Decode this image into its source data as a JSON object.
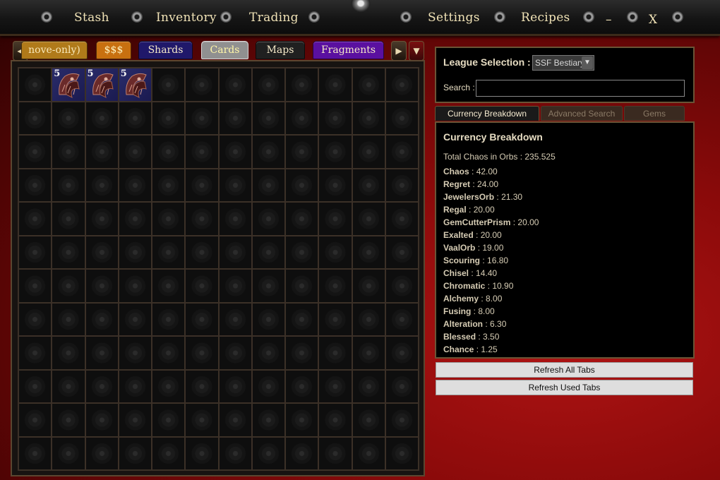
{
  "menu": {
    "items": [
      "Stash",
      "Inventory",
      "Trading",
      "Settings",
      "Recipes"
    ],
    "minimize": "–",
    "close": "X"
  },
  "tabs": {
    "items": [
      {
        "label": "nove-only)",
        "color": "#b07a1a"
      },
      {
        "label": "$$$",
        "color": "#c87010"
      },
      {
        "label": "Shards",
        "color": "#20186a"
      },
      {
        "label": "Cards",
        "color": "#909090"
      },
      {
        "label": "Maps",
        "color": "#202020"
      },
      {
        "label": "Fragments",
        "color": "#5a10a0"
      }
    ],
    "prev_icon": "left-arrow",
    "next_icon": "right-arrow",
    "menu_icon": "chevron-down"
  },
  "stash": {
    "items": [
      {
        "stack": "5",
        "col": 1
      },
      {
        "stack": "5",
        "col": 2
      },
      {
        "stack": "5",
        "col": 3
      }
    ]
  },
  "league": {
    "label": "League Selection :",
    "selected": "SSF Bestiary",
    "search_label": "Search :",
    "search_value": ""
  },
  "subtabs": [
    "Currency Breakdown",
    "Advanced Search",
    "Gems"
  ],
  "breakdown": {
    "title": "Currency Breakdown",
    "total": "Total Chaos in Orbs : 235.525",
    "rows": [
      {
        "name": "Chaos",
        "value": "42.00"
      },
      {
        "name": "Regret",
        "value": "24.00"
      },
      {
        "name": "JewelersOrb",
        "value": "21.30"
      },
      {
        "name": "Regal",
        "value": "20.00"
      },
      {
        "name": "GemCutterPrism",
        "value": "20.00"
      },
      {
        "name": "Exalted",
        "value": "20.00"
      },
      {
        "name": "VaalOrb",
        "value": "19.00"
      },
      {
        "name": "Scouring",
        "value": "16.80"
      },
      {
        "name": "Chisel",
        "value": "14.40"
      },
      {
        "name": "Chromatic",
        "value": "10.90"
      },
      {
        "name": "Alchemy",
        "value": "8.00"
      },
      {
        "name": "Fusing",
        "value": "8.00"
      },
      {
        "name": "Alteration",
        "value": "6.30"
      },
      {
        "name": "Blessed",
        "value": "3.50"
      },
      {
        "name": "Chance",
        "value": "1.25"
      }
    ]
  },
  "buttons": {
    "refresh_all": "Refresh All Tabs",
    "refresh_used": "Refresh Used Tabs"
  }
}
